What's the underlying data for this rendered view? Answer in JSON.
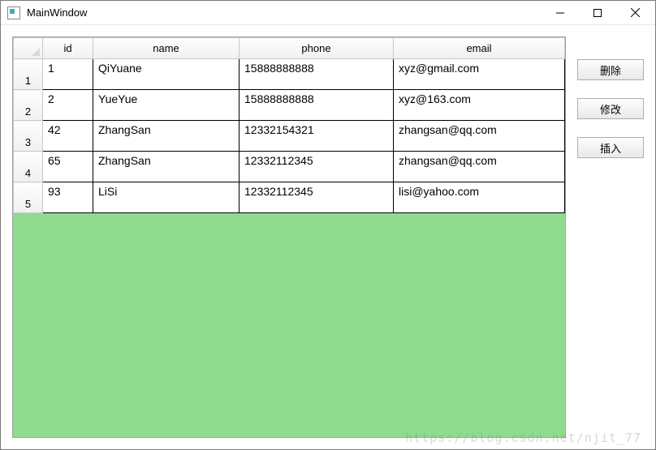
{
  "window": {
    "title": "MainWindow"
  },
  "table": {
    "headers": {
      "id": "id",
      "name": "name",
      "phone": "phone",
      "email": "email"
    },
    "rows": [
      {
        "n": "1",
        "id": "1",
        "name": "QiYuane",
        "phone": "15888888888",
        "email": "xyz@gmail.com"
      },
      {
        "n": "2",
        "id": "2",
        "name": "YueYue",
        "phone": "15888888888",
        "email": "xyz@163.com"
      },
      {
        "n": "3",
        "id": "42",
        "name": "ZhangSan",
        "phone": "12332154321",
        "email": "zhangsan@qq.com"
      },
      {
        "n": "4",
        "id": "65",
        "name": "ZhangSan",
        "phone": "12332112345",
        "email": "zhangsan@qq.com"
      },
      {
        "n": "5",
        "id": "93",
        "name": "LiSi",
        "phone": "12332112345",
        "email": "lisi@yahoo.com"
      }
    ]
  },
  "buttons": {
    "delete": "删除",
    "modify": "修改",
    "insert": "插入"
  },
  "watermark": "https://blog.csdn.net/njit_77"
}
